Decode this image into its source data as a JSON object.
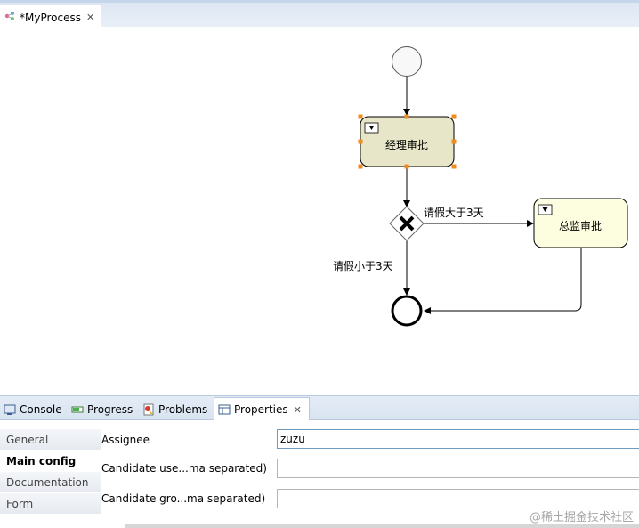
{
  "editor": {
    "tab_title": "*MyProcess",
    "close_glyph": "✕"
  },
  "diagram": {
    "task_manager": "经理审批",
    "task_director": "总监审批",
    "flow_more": "请假大于3天",
    "flow_less": "请假小于3天"
  },
  "views": {
    "tabs": [
      {
        "label": "Console",
        "icon": "console-icon"
      },
      {
        "label": "Progress",
        "icon": "progress-icon"
      },
      {
        "label": "Problems",
        "icon": "problems-icon"
      },
      {
        "label": "Properties",
        "icon": "properties-icon"
      }
    ],
    "close_glyph": "✕"
  },
  "properties": {
    "sections": [
      "General",
      "Main config",
      "Documentation",
      "Form"
    ],
    "fields": [
      {
        "label": "Assignee",
        "value": "zuzu"
      },
      {
        "label": "Candidate use...ma separated)",
        "value": ""
      },
      {
        "label": "Candidate gro...ma separated)",
        "value": ""
      }
    ]
  },
  "watermark": "@稀土掘金技术社区",
  "colors": {
    "accent": "#4a78b4",
    "task_selected_fill": "#e8e6c8",
    "task_fill": "#fdfde0",
    "handle": "#f28c1e"
  }
}
